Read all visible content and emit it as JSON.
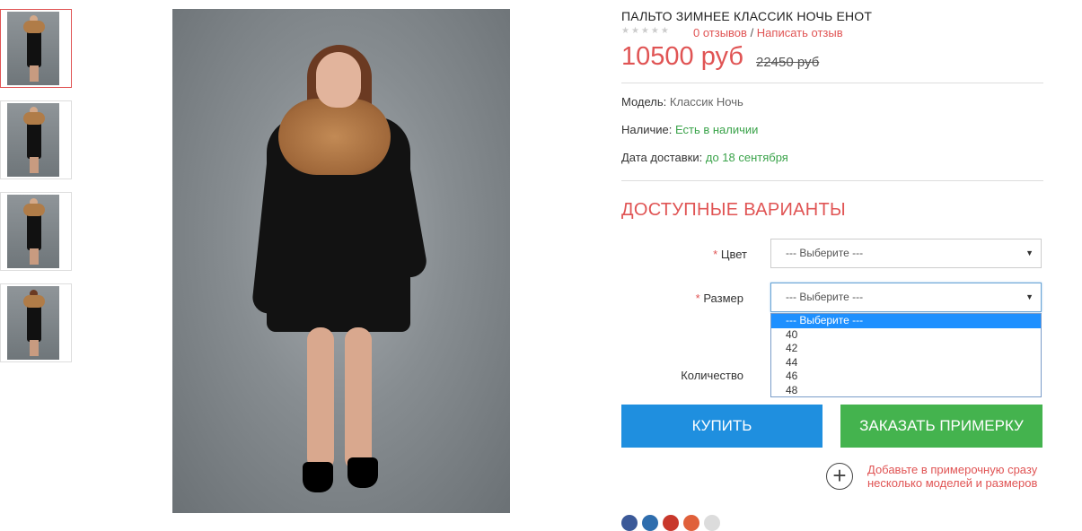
{
  "product": {
    "title": "ПАЛЬТО ЗИМНЕЕ КЛАССИК НОЧЬ ЕНОТ",
    "rating_stars": "★★★★★",
    "reviews_link": "0 отзывов",
    "review_sep": " / ",
    "write_review_link": "Написать отзыв",
    "price": "10500 руб",
    "old_price": "22450 руб"
  },
  "specs": {
    "model_label": "Модель:",
    "model_value": "Классик Ночь",
    "availability_label": "Наличие:",
    "availability_value": "Есть в наличии",
    "delivery_label": "Дата доставки:",
    "delivery_value": "до 18 сентября"
  },
  "options": {
    "heading": "ДОСТУПНЫЕ ВАРИАНТЫ",
    "required_mark": "*",
    "color_label": "Цвет",
    "color_selected": "--- Выберите ---",
    "size_label": "Размер",
    "size_selected": "--- Выберите ---",
    "size_options": [
      "--- Выберите ---",
      "40",
      "42",
      "44",
      "46",
      "48"
    ],
    "quantity_label": "Количество"
  },
  "actions": {
    "buy_label": "КУПИТЬ",
    "fitting_label": "ЗАКАЗАТЬ ПРИМЕРКУ",
    "add_note": "Добавьте в примерочную сразу несколько моделей и размеров",
    "plus_glyph": "+"
  },
  "icons": {
    "arrow": "▼"
  },
  "colors": {
    "accent": "#e05454",
    "buy": "#1f8fdf",
    "fitting": "#44b34e",
    "in_stock": "#3aa34a",
    "social": [
      "#3b5998",
      "#2e6dad",
      "#c8372b",
      "#e0603a",
      "#dcdcdc"
    ]
  }
}
